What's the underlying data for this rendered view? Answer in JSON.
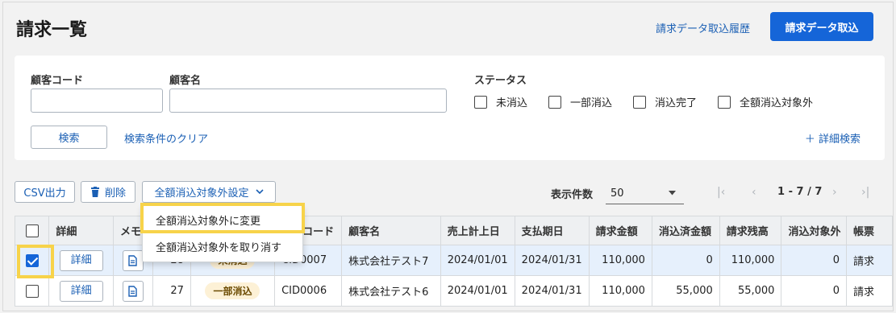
{
  "header": {
    "title": "請求一覧",
    "history_link": "請求データ取込履歴",
    "import_button": "請求データ取込"
  },
  "search": {
    "customer_code_label": "顧客コード",
    "customer_code_value": "",
    "customer_name_label": "顧客名",
    "customer_name_value": "",
    "status_label": "ステータス",
    "statuses": [
      "未消込",
      "一部消込",
      "消込完了",
      "全額消込対象外"
    ],
    "search_button": "検索",
    "clear_link": "検索条件のクリア",
    "advanced_link": "＋ 詳細検索"
  },
  "toolbar": {
    "csv_button": "CSV出力",
    "delete_button": "削除",
    "bulk_menu_button": "全額消込対象外設定",
    "per_page_label": "表示件数",
    "per_page_value": "50",
    "range": "1 - 7 / 7"
  },
  "dropdown": {
    "items": [
      "全額消込対象外に変更",
      "全額消込対象外を取り消す"
    ]
  },
  "table": {
    "headers": [
      "詳細",
      "メモ",
      "",
      "",
      "顧客コード",
      "顧客名",
      "売上計上日",
      "支払期日",
      "請求金額",
      "消込済金額",
      "請求残高",
      "消込対象外",
      "帳票"
    ],
    "detail_label": "詳細",
    "rows": [
      {
        "no": "28",
        "status": "未消込",
        "code": "CID0007",
        "name": "株式会社テスト7",
        "sales_date": "2024/01/01",
        "due_date": "2024/01/31",
        "amount": "110,000",
        "cleared": "0",
        "balance": "110,000",
        "excluded": "0",
        "form": "請求"
      },
      {
        "no": "27",
        "status": "一部消込",
        "code": "CID0006",
        "name": "株式会社テスト6",
        "sales_date": "2024/01/01",
        "due_date": "2024/01/31",
        "amount": "110,000",
        "cleared": "55,000",
        "balance": "55,000",
        "excluded": "0",
        "form": "請求"
      }
    ]
  },
  "colors": {
    "primary": "#1565d8",
    "link": "#1a5fb4",
    "highlight": "#f7d34a",
    "selected_row": "#e6f0fc"
  }
}
